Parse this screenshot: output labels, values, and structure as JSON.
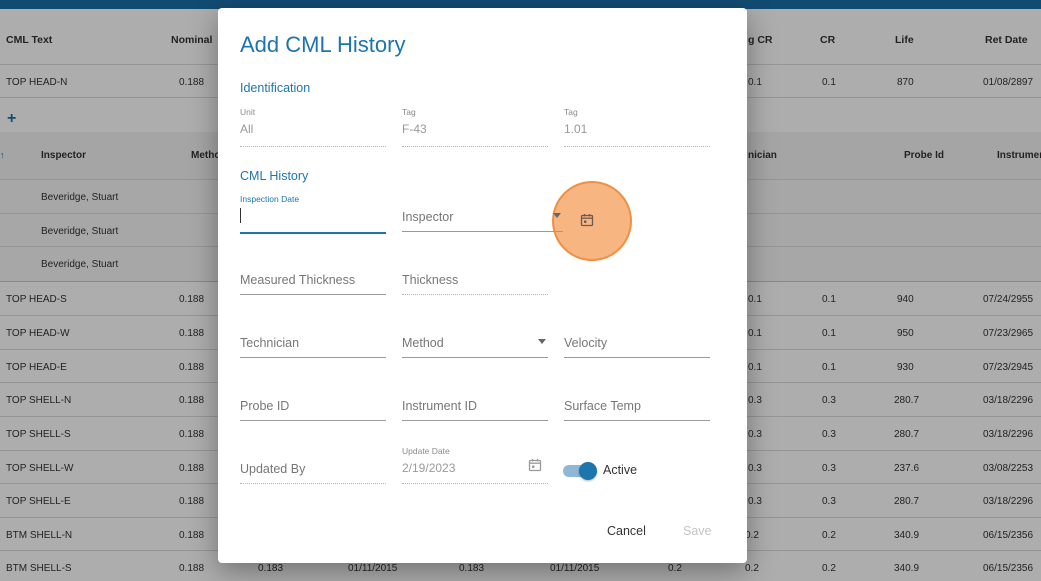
{
  "background": {
    "headers": {
      "cml_text": "CML Text",
      "nominal": "Nominal",
      "lt_cr": "g CR",
      "cr": "CR",
      "life": "Life",
      "ret_date": "Ret Date"
    },
    "top_rows": [
      {
        "name": "TOP HEAD-N",
        "nominal": "0.188",
        "lt": "0.1",
        "cr": "0.1",
        "life": "870",
        "ret": "01/08/2897"
      }
    ],
    "sub_headers": {
      "inspector": "Inspector",
      "method": "Metho",
      "technician": "nician",
      "probe_id": "Probe Id",
      "instrument": "Instrumen"
    },
    "sub_rows": [
      "Beveridge, Stuart",
      "Beveridge, Stuart",
      "Beveridge, Stuart"
    ],
    "rows": [
      {
        "name": "TOP HEAD-S",
        "nominal": "0.188",
        "lt": "0.1",
        "cr": "0.1",
        "life": "940",
        "ret": "07/24/2955"
      },
      {
        "name": "TOP HEAD-W",
        "nominal": "0.188",
        "lt": "0.1",
        "cr": "0.1",
        "life": "950",
        "ret": "07/23/2965"
      },
      {
        "name": "TOP HEAD-E",
        "nominal": "0.188",
        "lt": "0.1",
        "cr": "0.1",
        "life": "930",
        "ret": "07/23/2945"
      },
      {
        "name": "TOP SHELL-N",
        "nominal": "0.188",
        "lt": "0.3",
        "cr": "0.3",
        "life": "280.7",
        "ret": "03/18/2296"
      },
      {
        "name": "TOP SHELL-S",
        "nominal": "0.188",
        "lt": "0.3",
        "cr": "0.3",
        "life": "280.7",
        "ret": "03/18/2296"
      },
      {
        "name": "TOP SHELL-W",
        "nominal": "0.188",
        "lt": "0.3",
        "cr": "0.3",
        "life": "237.6",
        "ret": "03/08/2253"
      },
      {
        "name": "TOP SHELL-E",
        "nominal": "0.188",
        "lt": "0.3",
        "cr": "0.3",
        "life": "280.7",
        "ret": "03/18/2296"
      },
      {
        "name": "BTM SHELL-N",
        "nominal": "0.188",
        "lt": "0.2",
        "cr": "0.2",
        "life": "340.9",
        "ret": "06/15/2356"
      },
      {
        "name": "BTM SHELL-S",
        "nominal": "0.188",
        "lt": "0.2",
        "cr": "0.2",
        "life": "340.9",
        "ret": "06/15/2356",
        "c1": "0.183",
        "c2": "01/11/2015",
        "c3": "0.183",
        "c4": "01/11/2015"
      }
    ]
  },
  "dialog": {
    "title": "Add CML History",
    "identification_label": "Identification",
    "unit": {
      "label": "Unit",
      "value": "All"
    },
    "tag": {
      "label": "Tag",
      "value": "F-43"
    },
    "tag2": {
      "label": "Tag",
      "value": "1.01"
    },
    "cml_history_label": "CML History",
    "inspection_date": {
      "label": "Inspection Date",
      "value": ""
    },
    "inspector": {
      "placeholder": "Inspector"
    },
    "measured_thickness": {
      "placeholder": "Measured Thickness"
    },
    "thickness": {
      "placeholder": "Thickness"
    },
    "technician": {
      "placeholder": "Technician"
    },
    "method": {
      "placeholder": "Method"
    },
    "velocity": {
      "placeholder": "Velocity"
    },
    "probe_id": {
      "placeholder": "Probe ID"
    },
    "instrument_id": {
      "placeholder": "Instrument ID"
    },
    "surface_temp": {
      "placeholder": "Surface Temp"
    },
    "updated_by": {
      "placeholder": "Updated By"
    },
    "update_date": {
      "label": "Update Date",
      "value": "2/19/2023"
    },
    "active": {
      "label": "Active",
      "on": true
    },
    "cancel_label": "Cancel",
    "save_label": "Save"
  },
  "colors": {
    "accent": "#1d75ad",
    "topbar": "#1b6fa8",
    "touch": "#f5a05f"
  },
  "icons": {
    "date_picker": "calendar-icon",
    "dropdown": "chevron-down-icon",
    "add": "plus-icon"
  }
}
